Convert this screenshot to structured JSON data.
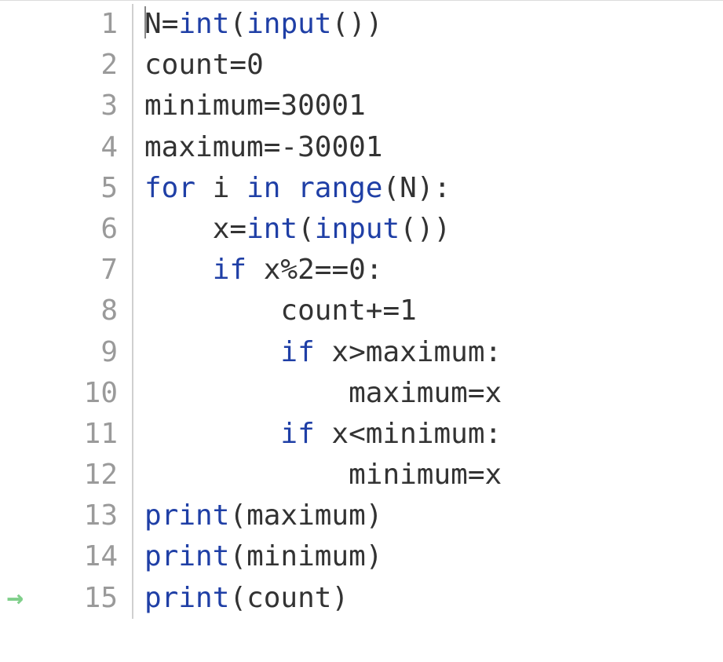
{
  "editor": {
    "current_line_arrow_glyph": "→",
    "lines": [
      {
        "n": 1,
        "arrow": false,
        "cursor": true,
        "tokens": [
          {
            "cls": "tok-name",
            "t": "N"
          },
          {
            "cls": "tok-op",
            "t": "="
          },
          {
            "cls": "tok-builtin",
            "t": "int"
          },
          {
            "cls": "tok-punct",
            "t": "("
          },
          {
            "cls": "tok-builtin",
            "t": "input"
          },
          {
            "cls": "tok-punct",
            "t": "())"
          }
        ]
      },
      {
        "n": 2,
        "arrow": false,
        "tokens": [
          {
            "cls": "tok-name",
            "t": "count"
          },
          {
            "cls": "tok-op",
            "t": "="
          },
          {
            "cls": "tok-num",
            "t": "0"
          }
        ]
      },
      {
        "n": 3,
        "arrow": false,
        "tokens": [
          {
            "cls": "tok-name",
            "t": "minimum"
          },
          {
            "cls": "tok-op",
            "t": "="
          },
          {
            "cls": "tok-num",
            "t": "30001"
          }
        ]
      },
      {
        "n": 4,
        "arrow": false,
        "tokens": [
          {
            "cls": "tok-name",
            "t": "maximum"
          },
          {
            "cls": "tok-op",
            "t": "="
          },
          {
            "cls": "tok-op",
            "t": "-"
          },
          {
            "cls": "tok-num",
            "t": "30001"
          }
        ]
      },
      {
        "n": 5,
        "arrow": false,
        "tokens": [
          {
            "cls": "tok-kw",
            "t": "for "
          },
          {
            "cls": "tok-name",
            "t": "i "
          },
          {
            "cls": "tok-kw",
            "t": "in "
          },
          {
            "cls": "tok-builtin",
            "t": "range"
          },
          {
            "cls": "tok-punct",
            "t": "("
          },
          {
            "cls": "tok-name",
            "t": "N"
          },
          {
            "cls": "tok-punct",
            "t": "):"
          }
        ]
      },
      {
        "n": 6,
        "arrow": false,
        "indent": "    ",
        "tokens": [
          {
            "cls": "tok-name",
            "t": "x"
          },
          {
            "cls": "tok-op",
            "t": "="
          },
          {
            "cls": "tok-builtin",
            "t": "int"
          },
          {
            "cls": "tok-punct",
            "t": "("
          },
          {
            "cls": "tok-builtin",
            "t": "input"
          },
          {
            "cls": "tok-punct",
            "t": "())"
          }
        ]
      },
      {
        "n": 7,
        "arrow": false,
        "indent": "    ",
        "tokens": [
          {
            "cls": "tok-kw",
            "t": "if "
          },
          {
            "cls": "tok-name",
            "t": "x"
          },
          {
            "cls": "tok-op",
            "t": "%"
          },
          {
            "cls": "tok-num",
            "t": "2"
          },
          {
            "cls": "tok-op",
            "t": "=="
          },
          {
            "cls": "tok-num",
            "t": "0"
          },
          {
            "cls": "tok-punct",
            "t": ":"
          }
        ]
      },
      {
        "n": 8,
        "arrow": false,
        "indent": "        ",
        "tokens": [
          {
            "cls": "tok-name",
            "t": "count"
          },
          {
            "cls": "tok-op",
            "t": "+="
          },
          {
            "cls": "tok-num",
            "t": "1"
          }
        ]
      },
      {
        "n": 9,
        "arrow": false,
        "indent": "        ",
        "tokens": [
          {
            "cls": "tok-kw",
            "t": "if "
          },
          {
            "cls": "tok-name",
            "t": "x"
          },
          {
            "cls": "tok-op",
            "t": ">"
          },
          {
            "cls": "tok-name",
            "t": "maximum"
          },
          {
            "cls": "tok-punct",
            "t": ":"
          }
        ]
      },
      {
        "n": 10,
        "arrow": false,
        "indent": "            ",
        "tokens": [
          {
            "cls": "tok-name",
            "t": "maximum"
          },
          {
            "cls": "tok-op",
            "t": "="
          },
          {
            "cls": "tok-name",
            "t": "x"
          }
        ]
      },
      {
        "n": 11,
        "arrow": false,
        "indent": "        ",
        "tokens": [
          {
            "cls": "tok-kw",
            "t": "if "
          },
          {
            "cls": "tok-name",
            "t": "x"
          },
          {
            "cls": "tok-op",
            "t": "<"
          },
          {
            "cls": "tok-name",
            "t": "minimum"
          },
          {
            "cls": "tok-punct",
            "t": ":"
          }
        ]
      },
      {
        "n": 12,
        "arrow": false,
        "indent": "            ",
        "tokens": [
          {
            "cls": "tok-name",
            "t": "minimum"
          },
          {
            "cls": "tok-op",
            "t": "="
          },
          {
            "cls": "tok-name",
            "t": "x"
          }
        ]
      },
      {
        "n": 13,
        "arrow": false,
        "tokens": [
          {
            "cls": "tok-builtin",
            "t": "print"
          },
          {
            "cls": "tok-punct",
            "t": "("
          },
          {
            "cls": "tok-name",
            "t": "maximum"
          },
          {
            "cls": "tok-punct",
            "t": ")"
          }
        ]
      },
      {
        "n": 14,
        "arrow": false,
        "tokens": [
          {
            "cls": "tok-builtin",
            "t": "print"
          },
          {
            "cls": "tok-punct",
            "t": "("
          },
          {
            "cls": "tok-name",
            "t": "minimum"
          },
          {
            "cls": "tok-punct",
            "t": ")"
          }
        ]
      },
      {
        "n": 15,
        "arrow": true,
        "tokens": [
          {
            "cls": "tok-builtin",
            "t": "print"
          },
          {
            "cls": "tok-punct",
            "t": "("
          },
          {
            "cls": "tok-name",
            "t": "count"
          },
          {
            "cls": "tok-punct",
            "t": ")"
          }
        ]
      }
    ]
  }
}
